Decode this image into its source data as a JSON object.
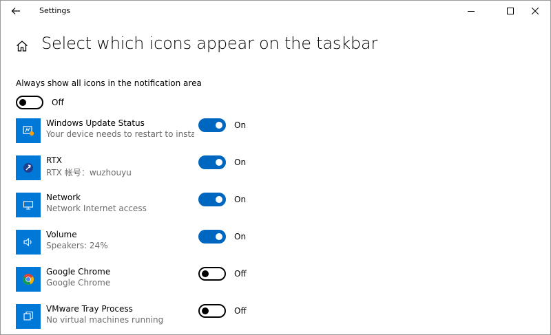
{
  "window": {
    "title": "Settings"
  },
  "page": {
    "title": "Select which icons appear on the taskbar",
    "always_show": {
      "label": "Always show all icons in the notification area",
      "state": "Off"
    }
  },
  "apps": [
    {
      "name": "Windows Update Status",
      "desc": "Your device needs to restart to insta...",
      "state": "On",
      "icon": "windows-update-icon"
    },
    {
      "name": "RTX",
      "desc": "RTX 帐号：wuzhouyu",
      "state": "On",
      "icon": "rtx-icon"
    },
    {
      "name": "Network",
      "desc": "Network Internet access",
      "state": "On",
      "icon": "network-icon"
    },
    {
      "name": "Volume",
      "desc": "Speakers: 24%",
      "state": "On",
      "icon": "volume-icon"
    },
    {
      "name": "Google Chrome",
      "desc": "Google Chrome",
      "state": "Off",
      "icon": "chrome-icon"
    },
    {
      "name": "VMware Tray Process",
      "desc": "No virtual machines running",
      "state": "Off",
      "icon": "vmware-icon"
    }
  ],
  "colors": {
    "accent": "#0067c0",
    "tile": "#0078d7",
    "secondary_text": "#6b6b6b"
  }
}
